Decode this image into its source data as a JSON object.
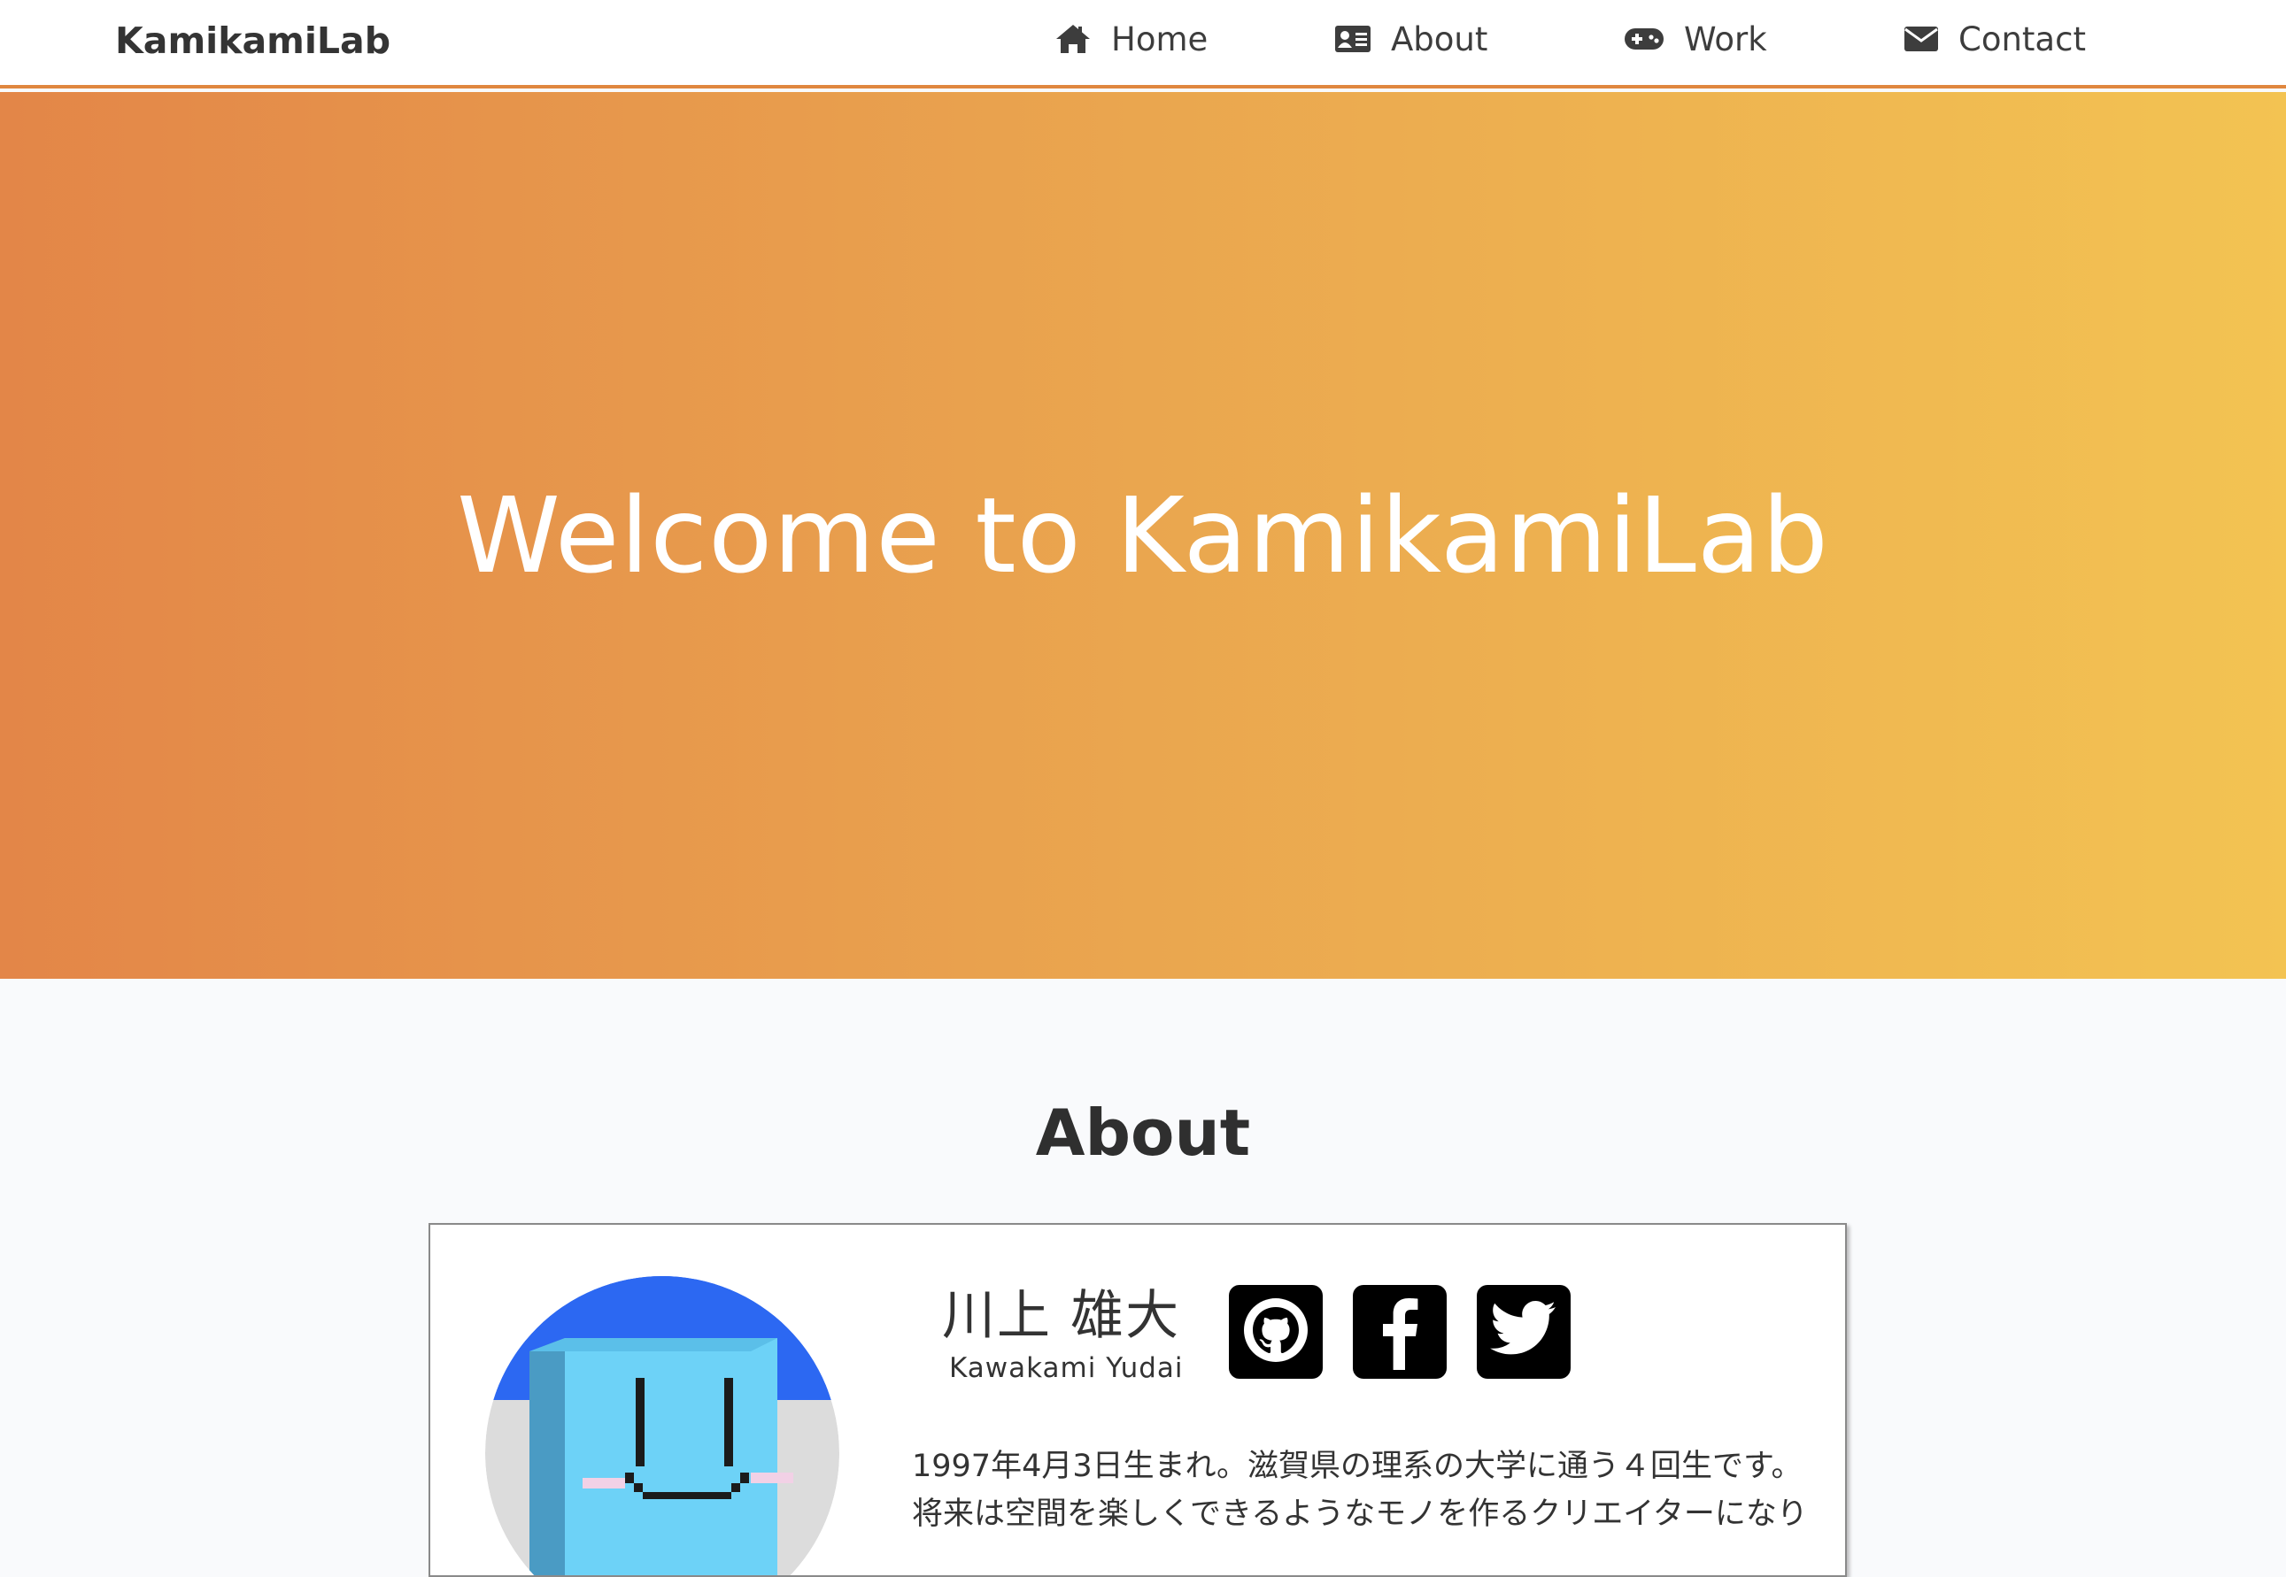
{
  "nav": {
    "brand": "KamikamiLab",
    "items": [
      {
        "label": "Home",
        "icon": "home-icon"
      },
      {
        "label": "About",
        "icon": "id-card-icon"
      },
      {
        "label": "Work",
        "icon": "gamepad-icon"
      },
      {
        "label": "Contact",
        "icon": "envelope-icon"
      }
    ]
  },
  "hero": {
    "title": "Welcome to KamikamiLab",
    "colors": {
      "start": "#e38648",
      "end": "#f3c352"
    }
  },
  "about": {
    "heading": "About",
    "name_ja": "川上 雄大",
    "name_en": "Kawakami Yudai",
    "social": [
      {
        "icon": "github-icon"
      },
      {
        "icon": "facebook-icon"
      },
      {
        "icon": "twitter-icon"
      }
    ],
    "bio_lines": [
      "1997年4月3日生まれ。滋賀県の理系の大学に通う４回生です。",
      "将来は空間を楽しくできるようなモノを作るクリエイターになり"
    ]
  }
}
